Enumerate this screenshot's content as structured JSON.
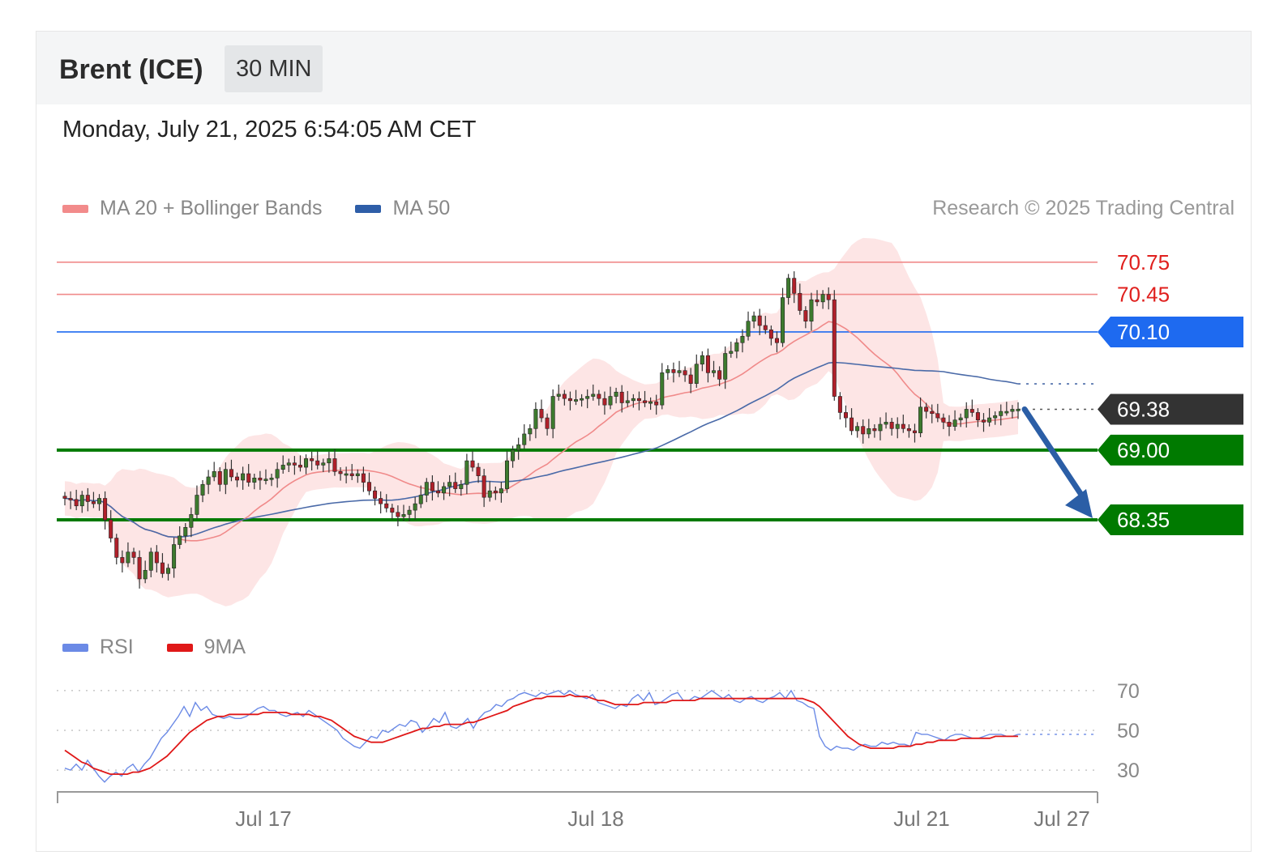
{
  "header": {
    "instrument": "Brent (ICE)",
    "timeframe": "30 MIN",
    "datetime": "Monday, July 21, 2025 6:54:05 AM CET"
  },
  "legend_main": [
    {
      "label": "MA 20 + Bollinger Bands",
      "color": "#f28b8b"
    },
    {
      "label": "MA 50",
      "color": "#2e5ea8"
    }
  ],
  "legend_rsi": [
    {
      "label": "RSI",
      "color": "#6b8ae6"
    },
    {
      "label": "9MA",
      "color": "#e01818"
    }
  ],
  "copyright": "Research © 2025 Trading Central",
  "colors": {
    "up": "#3d7a2e",
    "down": "#b0202a",
    "wick": "#333333",
    "resistance": "#f08a8a",
    "resistance_text": "#e0201e",
    "pivot": "#1e6af0",
    "support": "#007a00",
    "last": "#333333",
    "arrow": "#2b5ea6",
    "band": "#fde0e0",
    "ma20": "#f08a8a",
    "ma50": "#4a6aa8"
  },
  "chart_data": [
    {
      "type": "candlestick",
      "ylim": [
        67.4,
        71.05
      ],
      "x_labels": [
        "Jul 17",
        "Jul 18",
        "Jul 21",
        "Jul 27"
      ],
      "levels": [
        {
          "kind": "resistance",
          "value": 70.75,
          "label": "70.75"
        },
        {
          "kind": "resistance",
          "value": 70.45,
          "label": "70.45"
        },
        {
          "kind": "pivot",
          "value": 70.1,
          "label": "70.10"
        },
        {
          "kind": "last",
          "value": 69.38,
          "label": "69.38"
        },
        {
          "kind": "support",
          "value": 69.0,
          "label": "69.00"
        },
        {
          "kind": "support",
          "value": 68.35,
          "label": "68.35"
        }
      ],
      "forecast": {
        "from": 69.38,
        "to": 68.35,
        "direction": "down"
      },
      "close": [
        68.55,
        68.54,
        68.48,
        68.58,
        68.52,
        68.5,
        68.55,
        68.35,
        68.18,
        68.0,
        67.95,
        68.05,
        68.0,
        67.8,
        67.88,
        68.05,
        67.95,
        67.85,
        67.9,
        68.12,
        68.2,
        68.28,
        68.4,
        68.58,
        68.68,
        68.75,
        68.8,
        68.68,
        68.82,
        68.75,
        68.72,
        68.78,
        68.7,
        68.74,
        68.72,
        68.73,
        68.74,
        68.82,
        68.86,
        68.88,
        68.86,
        68.84,
        68.92,
        68.9,
        68.86,
        68.88,
        68.92,
        68.8,
        68.78,
        68.78,
        68.76,
        68.78,
        68.7,
        68.62,
        68.55,
        68.5,
        68.46,
        68.42,
        68.38,
        68.4,
        68.44,
        68.5,
        68.58,
        68.7,
        68.62,
        68.6,
        68.66,
        68.7,
        68.64,
        68.68,
        68.9,
        68.84,
        68.76,
        68.56,
        68.62,
        68.6,
        68.64,
        68.9,
        69.0,
        69.05,
        69.15,
        69.2,
        69.38,
        69.3,
        69.2,
        69.5,
        69.52,
        69.48,
        69.46,
        69.47,
        69.48,
        69.5,
        69.52,
        69.48,
        69.42,
        69.5,
        69.54,
        69.44,
        69.46,
        69.48,
        69.46,
        69.44,
        69.45,
        69.42,
        69.72,
        69.75,
        69.72,
        69.74,
        69.7,
        69.62,
        69.8,
        69.88,
        69.72,
        69.74,
        69.66,
        69.9,
        69.92,
        70.0,
        70.06,
        70.2,
        70.25,
        70.16,
        70.12,
        70.04,
        70.0,
        70.42,
        70.6,
        70.46,
        70.3,
        70.2,
        70.4,
        70.38,
        70.45,
        70.4,
        69.5,
        69.35,
        69.3,
        69.18,
        69.22,
        69.15,
        69.2,
        69.18,
        69.24,
        69.26,
        69.2,
        69.24,
        69.2,
        69.18,
        69.16,
        69.4,
        69.36,
        69.34,
        69.3,
        69.26,
        69.22,
        69.28,
        69.3,
        69.38,
        69.35,
        69.28,
        69.26,
        69.3,
        69.32,
        69.36,
        69.36,
        69.38,
        69.38
      ]
    },
    {
      "type": "line",
      "name": "RSI panel",
      "ylim": [
        15,
        85
      ],
      "y_ticks": [
        70,
        50,
        30
      ],
      "series": [
        {
          "name": "RSI",
          "values": [
            31,
            30,
            33,
            30,
            35,
            31,
            27,
            24,
            27,
            29,
            27,
            31,
            33,
            29,
            33,
            36,
            41,
            46,
            49,
            53,
            57,
            62,
            57,
            64,
            60,
            62,
            58,
            57,
            56,
            57,
            56,
            56,
            57,
            59,
            61,
            62,
            60,
            60,
            58,
            57,
            58,
            59,
            57,
            60,
            58,
            56,
            54,
            52,
            50,
            46,
            44,
            42,
            41,
            44,
            47,
            46,
            50,
            49,
            51,
            53,
            52,
            55,
            54,
            49,
            52,
            56,
            54,
            59,
            52,
            51,
            53,
            56,
            51,
            56,
            59,
            60,
            63,
            62,
            65,
            66,
            68,
            69,
            68,
            67,
            69,
            68,
            69,
            70,
            68,
            70,
            68,
            67,
            66,
            68,
            64,
            63,
            62,
            61,
            63,
            62,
            66,
            68,
            65,
            69,
            63,
            64,
            66,
            68,
            69,
            65,
            65,
            67,
            66,
            68,
            70,
            68,
            66,
            68,
            65,
            64,
            66,
            67,
            65,
            64,
            66,
            67,
            69,
            66,
            70,
            65,
            64,
            62,
            61,
            47,
            42,
            40,
            42,
            41,
            41,
            40,
            42,
            43,
            42,
            42,
            44,
            43,
            44,
            43,
            43,
            42,
            49,
            48,
            48,
            47,
            46,
            45,
            47,
            48,
            48,
            47,
            46,
            46,
            47,
            48,
            48,
            48,
            47,
            47,
            48
          ]
        },
        {
          "name": "9MA",
          "values": [
            40,
            38,
            36,
            34,
            33,
            31,
            30,
            29,
            28,
            28,
            28,
            28,
            29,
            29,
            30,
            31,
            33,
            35,
            37,
            40,
            43,
            46,
            49,
            51,
            53,
            55,
            56,
            57,
            57,
            58,
            58,
            58,
            58,
            58,
            58,
            59,
            59,
            59,
            59,
            59,
            58,
            58,
            58,
            58,
            57,
            57,
            56,
            55,
            53,
            51,
            49,
            47,
            46,
            45,
            44,
            44,
            44,
            45,
            46,
            47,
            48,
            49,
            50,
            51,
            51,
            52,
            52,
            53,
            53,
            53,
            53,
            54,
            54,
            55,
            56,
            57,
            58,
            59,
            60,
            62,
            63,
            64,
            65,
            66,
            66,
            67,
            67,
            67,
            67,
            68,
            67,
            67,
            67,
            66,
            65,
            65,
            64,
            63,
            63,
            63,
            63,
            63,
            64,
            64,
            64,
            64,
            64,
            65,
            65,
            65,
            65,
            65,
            66,
            66,
            66,
            66,
            66,
            66,
            66,
            66,
            66,
            66,
            66,
            66,
            66,
            66,
            66,
            66,
            66,
            66,
            66,
            65,
            64,
            62,
            59,
            56,
            53,
            50,
            47,
            45,
            43,
            42,
            41,
            41,
            41,
            41,
            41,
            42,
            42,
            42,
            43,
            43,
            44,
            44,
            45,
            45,
            45,
            45,
            46,
            46,
            46,
            46,
            46,
            46,
            47,
            47,
            47,
            47,
            47
          ]
        }
      ]
    }
  ]
}
